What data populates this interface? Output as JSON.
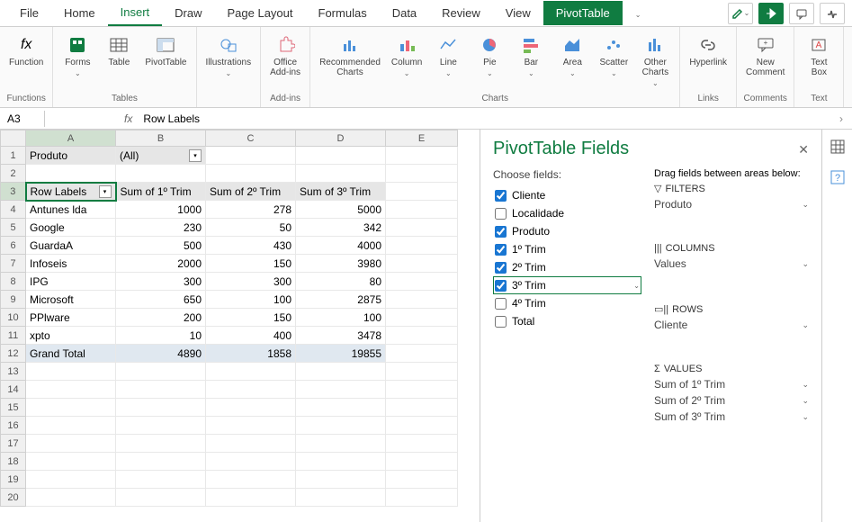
{
  "tabs": [
    "File",
    "Home",
    "Insert",
    "Draw",
    "Page Layout",
    "Formulas",
    "Data",
    "Review",
    "View",
    "PivotTable"
  ],
  "active_tab": "Insert",
  "pivot_tab": "PivotTable",
  "ribbon": {
    "groups": [
      {
        "label": "Functions",
        "items": [
          {
            "label": "Function"
          }
        ]
      },
      {
        "label": "Tables",
        "items": [
          {
            "label": "Forms"
          },
          {
            "label": "Table"
          },
          {
            "label": "PivotTable"
          }
        ]
      },
      {
        "label": "",
        "items": [
          {
            "label": "Illustrations"
          }
        ]
      },
      {
        "label": "Add-ins",
        "items": [
          {
            "label": "Office\nAdd-ins"
          }
        ]
      },
      {
        "label": "Charts",
        "items": [
          {
            "label": "Recommended\nCharts"
          },
          {
            "label": "Column"
          },
          {
            "label": "Line"
          },
          {
            "label": "Pie"
          },
          {
            "label": "Bar"
          },
          {
            "label": "Area"
          },
          {
            "label": "Scatter"
          },
          {
            "label": "Other\nCharts"
          }
        ]
      },
      {
        "label": "Links",
        "items": [
          {
            "label": "Hyperlink"
          }
        ]
      },
      {
        "label": "Comments",
        "items": [
          {
            "label": "New\nComment"
          }
        ]
      },
      {
        "label": "Text",
        "items": [
          {
            "label": "Text\nBox"
          }
        ]
      }
    ]
  },
  "name_box": "A3",
  "formula_value": "Row Labels",
  "columns": [
    "A",
    "B",
    "C",
    "D",
    "E"
  ],
  "pivot": {
    "filter_field": "Produto",
    "filter_value": "(All)",
    "row_labels_header": "Row Labels",
    "col_headers": [
      "Sum of 1º Trim",
      "Sum of 2º Trim",
      "Sum of 3º Trim"
    ],
    "rows": [
      {
        "label": "Antunes lda",
        "v": [
          1000,
          278,
          5000
        ]
      },
      {
        "label": "Google",
        "v": [
          230,
          50,
          342
        ]
      },
      {
        "label": "GuardaA",
        "v": [
          500,
          430,
          4000
        ]
      },
      {
        "label": "Infoseis",
        "v": [
          2000,
          150,
          3980
        ]
      },
      {
        "label": "IPG",
        "v": [
          300,
          300,
          80
        ]
      },
      {
        "label": "Microsoft",
        "v": [
          650,
          100,
          2875
        ]
      },
      {
        "label": "PPlware",
        "v": [
          200,
          150,
          100
        ]
      },
      {
        "label": "xpto",
        "v": [
          10,
          400,
          3478
        ]
      }
    ],
    "grand_total_label": "Grand Total",
    "grand_total": [
      4890,
      1858,
      19855
    ]
  },
  "field_pane": {
    "title": "PivotTable Fields",
    "choose_label": "Choose fields:",
    "drag_label": "Drag fields between areas below:",
    "fields": [
      {
        "name": "Cliente",
        "checked": true
      },
      {
        "name": "Localidade",
        "checked": false
      },
      {
        "name": "Produto",
        "checked": true
      },
      {
        "name": "1º Trim",
        "checked": true
      },
      {
        "name": "2º Trim",
        "checked": true
      },
      {
        "name": "3º Trim",
        "checked": true,
        "selected": true
      },
      {
        "name": "4º Trim",
        "checked": false
      },
      {
        "name": "Total",
        "checked": false
      }
    ],
    "areas": {
      "filters": {
        "title": "FILTERS",
        "items": [
          "Produto"
        ]
      },
      "columns": {
        "title": "COLUMNS",
        "items": [
          "Values"
        ]
      },
      "rows": {
        "title": "ROWS",
        "items": [
          "Cliente"
        ]
      },
      "values": {
        "title": "VALUES",
        "items": [
          "Sum of 1º Trim",
          "Sum of 2º Trim",
          "Sum of 3º Trim"
        ]
      }
    }
  }
}
